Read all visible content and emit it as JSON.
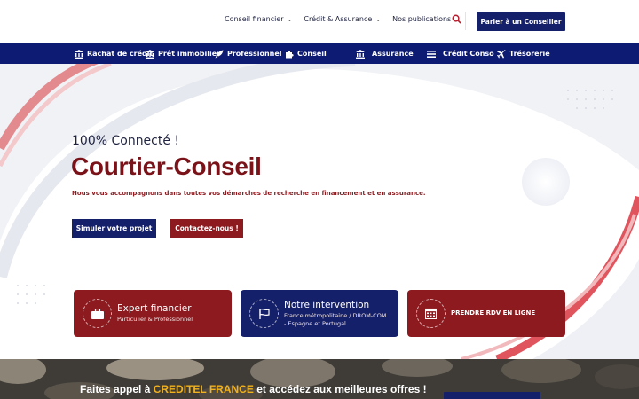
{
  "topnav": {
    "items": [
      {
        "label": "Conseil financier"
      },
      {
        "label": "Crédit & Assurance"
      },
      {
        "label": "Nos publications"
      }
    ],
    "cta_label": "Parler à un Conseiller"
  },
  "menubar": {
    "items": [
      {
        "label": "Rachat de crédit",
        "icon": "bank-icon"
      },
      {
        "label": "Prêt immobilier",
        "icon": "bank-icon"
      },
      {
        "label": "Professionnel",
        "icon": "rocket-icon"
      },
      {
        "label": "Conseil",
        "icon": "puzzle-icon"
      },
      {
        "label": "Assurance",
        "icon": "bank-icon"
      },
      {
        "label": "Crédit Conso",
        "icon": "list-icon"
      },
      {
        "label": "Trésorerie",
        "icon": "plane-icon"
      }
    ]
  },
  "hero": {
    "subtitle": "100% Connecté !",
    "title": "Courtier-Conseil",
    "description": "Nous vous accompagnons dans toutes vos démarches de recherche en financement et en assurance.",
    "btn_simulate": "Simuler votre projet",
    "btn_contact": "Contactez-nous !"
  },
  "cards": [
    {
      "title": "Expert financier",
      "line1": "Particulier & Professionnel",
      "icon": "briefcase-icon"
    },
    {
      "title": "Notre intervention",
      "line1": "France métropolitaine / DROM-COM",
      "line2": "- Espagne et Portugal",
      "icon": "flag-icon"
    },
    {
      "title": "PRENDRE RDV EN LIGNE",
      "icon": "calendar-icon"
    }
  ],
  "banner": {
    "text_before": "Faites appel à",
    "brand": "CREDITEL FRANCE",
    "text_after": "et accédez aux meilleures offres !"
  },
  "colors": {
    "navy": "#15206a",
    "menubar": "#0d1b73",
    "burgundy": "#8c1a1f",
    "title": "#7a1319",
    "brand_yellow": "#f1b21d"
  }
}
